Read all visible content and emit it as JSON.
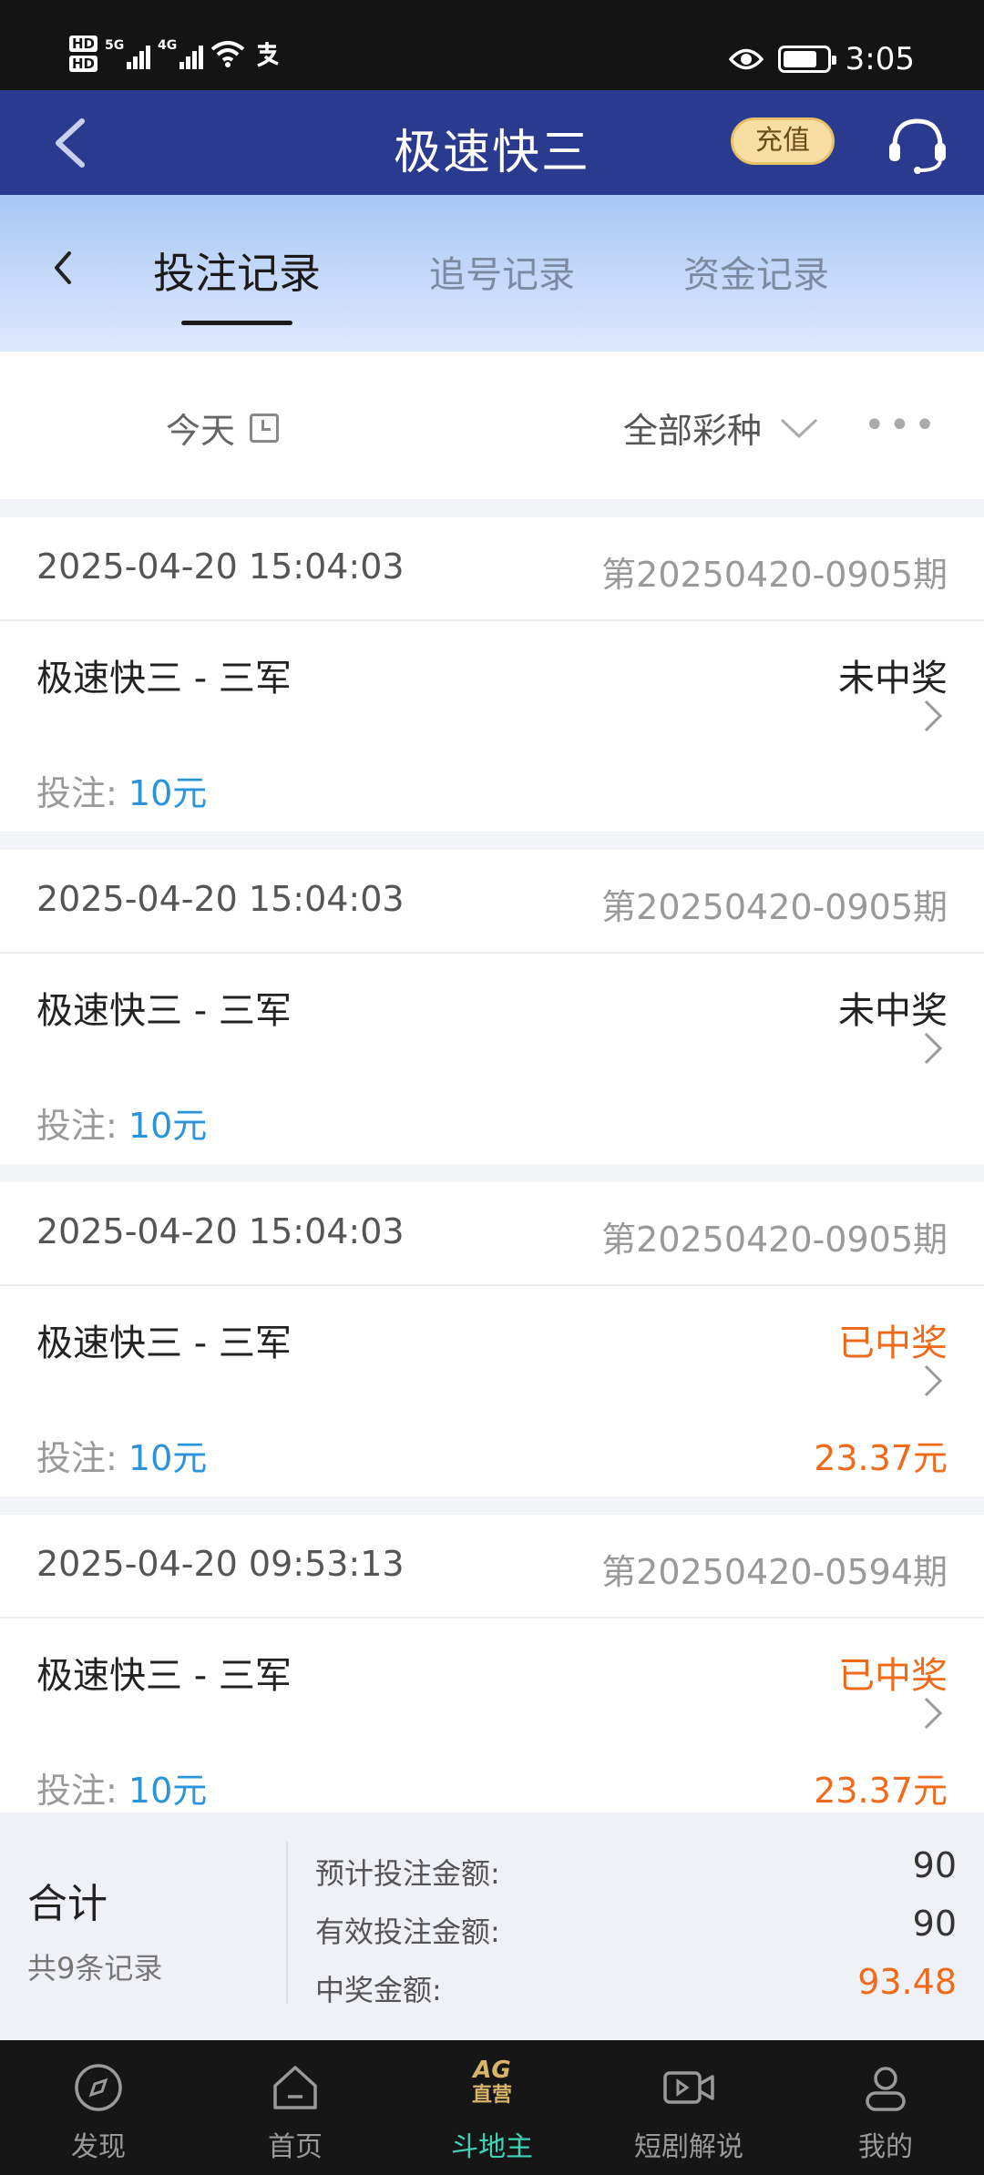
{
  "status_bar": {
    "hd1": "HD",
    "hd2": "HD",
    "net1": "5G",
    "net2": "4G",
    "time": "3:05"
  },
  "header": {
    "title": "极速快三",
    "recharge_label": "充值"
  },
  "tabs": [
    {
      "label": "投注记录",
      "active": true
    },
    {
      "label": "追号记录",
      "active": false
    },
    {
      "label": "资金记录",
      "active": false
    }
  ],
  "filter": {
    "date": "今天",
    "lottery_type": "全部彩种",
    "more": "•••"
  },
  "records": [
    {
      "time": "2025-04-20 15:04:03",
      "issue": "第20250420-0905期",
      "name": "极速快三 - 三军",
      "status": "未中奖",
      "bet_label": "投注: ",
      "bet_amount": "10元",
      "prize": ""
    },
    {
      "time": "2025-04-20 15:04:03",
      "issue": "第20250420-0905期",
      "name": "极速快三 - 三军",
      "status": "未中奖",
      "bet_label": "投注: ",
      "bet_amount": "10元",
      "prize": ""
    },
    {
      "time": "2025-04-20 15:04:03",
      "issue": "第20250420-0905期",
      "name": "极速快三 - 三军",
      "status": "已中奖",
      "bet_label": "投注: ",
      "bet_amount": "10元",
      "prize": "23.37元"
    },
    {
      "time": "2025-04-20 09:53:13",
      "issue": "第20250420-0594期",
      "name": "极速快三 - 三军",
      "status": "已中奖",
      "bet_label": "投注: ",
      "bet_amount": "10元",
      "prize": "23.37元"
    }
  ],
  "summary": {
    "title": "合计",
    "count": "共9条记录",
    "expected_label": "预计投注金额:",
    "expected_value": "90",
    "valid_label": "有效投注金额:",
    "valid_value": "90",
    "prize_label": "中奖金额:",
    "prize_value": "93.48"
  },
  "bottom_nav": [
    {
      "label": "发现",
      "icon": "compass-icon",
      "active": false
    },
    {
      "label": "首页",
      "icon": "home-icon",
      "active": false
    },
    {
      "label": "斗地主",
      "icon": "ag-logo-icon",
      "logo_top": "AG",
      "logo_bottom": "直营",
      "active": true
    },
    {
      "label": "短剧解说",
      "icon": "video-icon",
      "active": false
    },
    {
      "label": "我的",
      "icon": "user-icon",
      "active": false
    }
  ],
  "colors": {
    "header_bg": "#2a3a8e",
    "win": "#ef6a1b",
    "bet_amount": "#2b94d8",
    "nav_active": "#3fd4b8"
  }
}
